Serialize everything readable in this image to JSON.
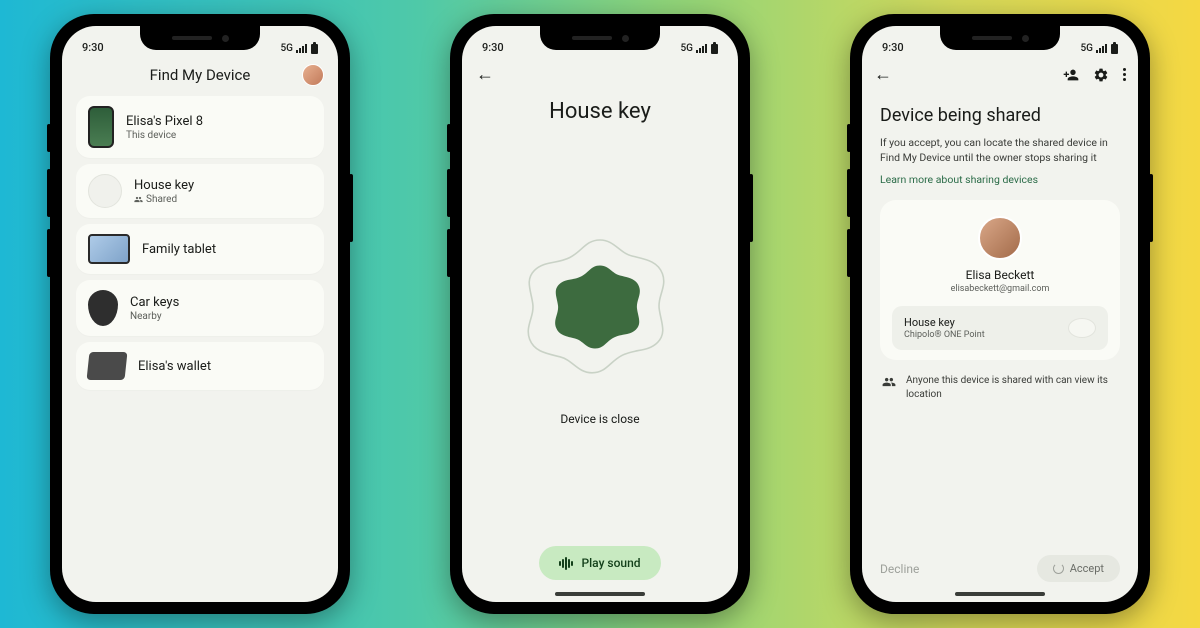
{
  "statusbar": {
    "time": "9:30",
    "network": "5G"
  },
  "screen1": {
    "title": "Find My Device",
    "devices": [
      {
        "name": "Elisa's Pixel 8",
        "sub": "This device"
      },
      {
        "name": "House key",
        "sub": "Shared"
      },
      {
        "name": "Family tablet",
        "sub": ""
      },
      {
        "name": "Car keys",
        "sub": "Nearby"
      },
      {
        "name": "Elisa's wallet",
        "sub": ""
      }
    ]
  },
  "screen2": {
    "title": "House key",
    "status": "Device is close",
    "play_label": "Play sound"
  },
  "screen3": {
    "title": "Device being shared",
    "description": "If you accept, you can locate the shared device in Find My Device until the owner stops sharing it",
    "link": "Learn more about sharing devices",
    "owner_name": "Elisa Beckett",
    "owner_email": "elisabeckett@gmail.com",
    "device_name": "House key",
    "device_model": "Chipolo® ONE Point",
    "notice": "Anyone this device is shared with can view its location",
    "decline": "Decline",
    "accept": "Accept"
  }
}
